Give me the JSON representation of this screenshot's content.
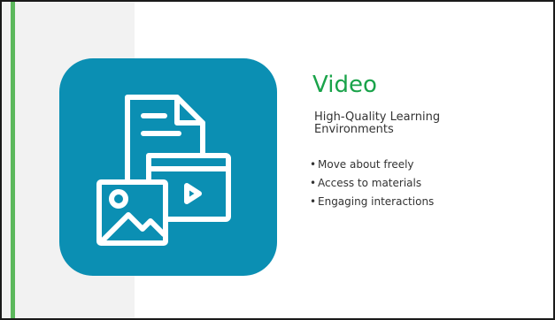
{
  "slide": {
    "title": "Video",
    "subtitle": "High-Quality Learning Environments",
    "bullets": [
      "Move about freely",
      "Access to materials",
      "Engaging interactions"
    ]
  },
  "icon": {
    "name": "document-image-video-icon",
    "tile_color": "#0b8fb3",
    "stroke_color": "#ffffff"
  },
  "colors": {
    "accent": "#5cb85c",
    "title": "#1aa34a",
    "left_band": "#f2f2f2",
    "text": "#333333"
  }
}
